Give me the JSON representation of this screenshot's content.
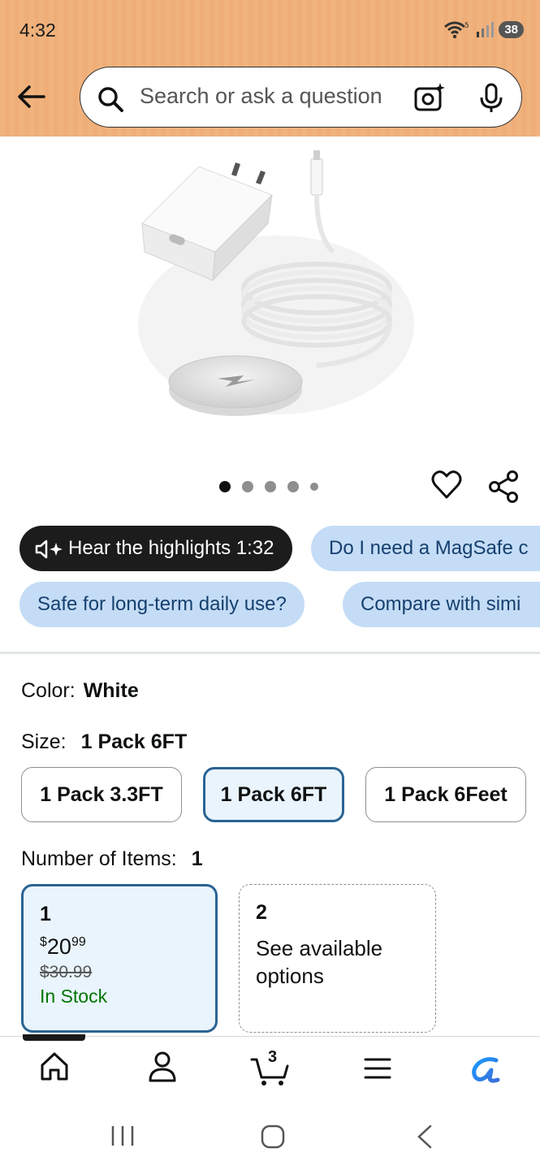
{
  "status_bar": {
    "time": "4:32",
    "battery": "38"
  },
  "search": {
    "placeholder": "Search or ask a question"
  },
  "carousel": {
    "dot_count": 5,
    "active_index": 0
  },
  "chips": {
    "hear_highlights": "Hear the highlights 1:32",
    "q1": "Do I need a MagSafe c",
    "q2": "Safe for long-term daily use?",
    "q3": "Compare with simi"
  },
  "color": {
    "label": "Color:",
    "value": "White"
  },
  "size": {
    "label": "Size:",
    "value": "1 Pack 6FT",
    "options": [
      "1 Pack 3.3FT",
      "1 Pack 6FT",
      "1 Pack 6Feet"
    ]
  },
  "items": {
    "label": "Number of Items:",
    "value": "1",
    "cards": [
      {
        "count": "1",
        "currency": "$",
        "price_whole": "20",
        "price_fraction": "99",
        "list_price": "$30.99",
        "availability": "In Stock"
      },
      {
        "count": "2",
        "text": "See available options"
      }
    ]
  },
  "bottom_nav": {
    "cart_count": "3",
    "items": [
      "home-icon",
      "account-icon",
      "cart-icon",
      "menu-icon",
      "rufus-icon"
    ]
  },
  "colors": {
    "accent_blue": "#2a6494",
    "chip_blue": "#c4dcf6",
    "in_stock_green": "#007600",
    "header_orange": "#f0b37e"
  }
}
